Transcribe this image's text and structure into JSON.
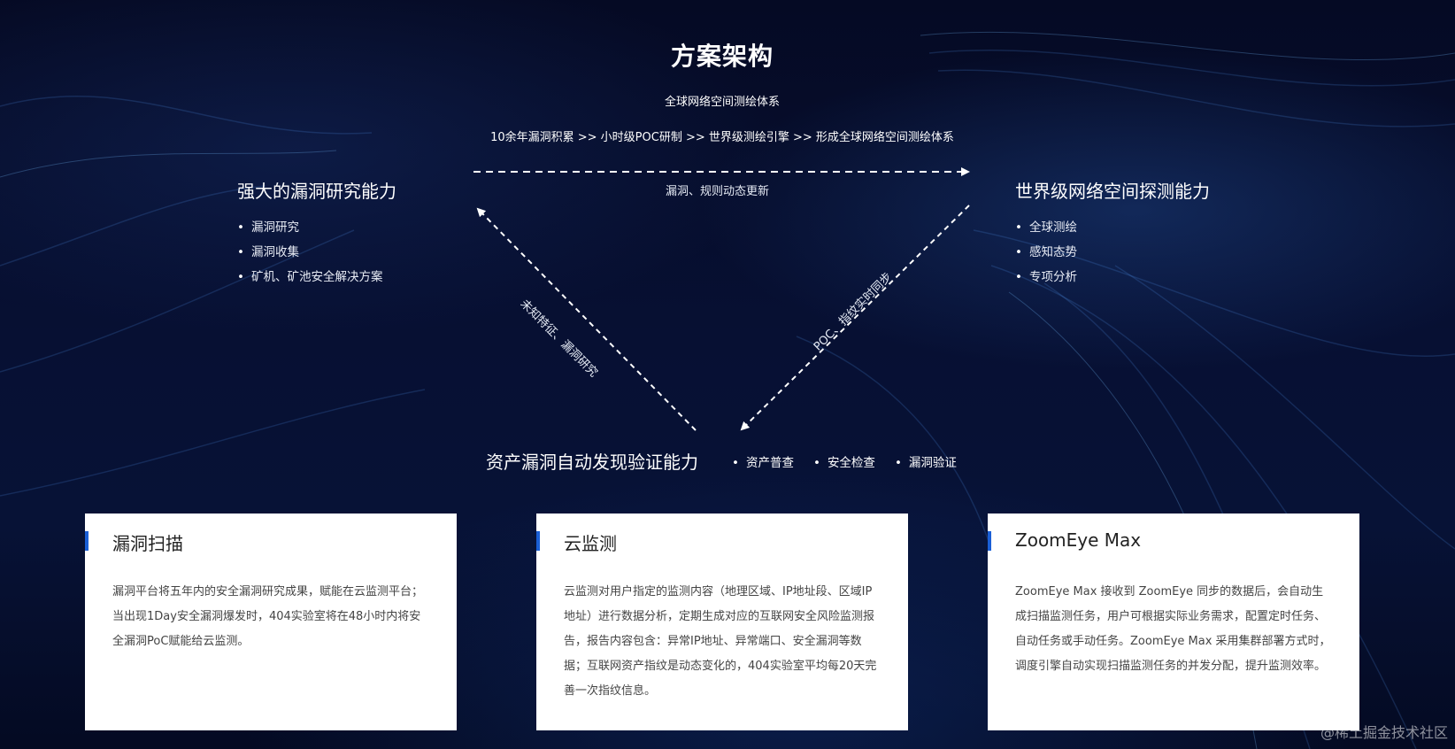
{
  "header": {
    "title": "方案架构",
    "subtitle": "全球网络空间测绘体系",
    "pipeline": "10余年漏洞积累 >> 小时级POC研制 >> 世界级测绘引擎 >> 形成全球网络空间测绘体系"
  },
  "nodes": {
    "left": {
      "title": "强大的漏洞研究能力",
      "items": [
        "漏洞研究",
        "漏洞收集",
        "矿机、矿池安全解决方案"
      ]
    },
    "right": {
      "title": "世界级网络空间探测能力",
      "items": [
        "全球测绘",
        "感知态势",
        "专项分析"
      ]
    },
    "bottom": {
      "title": "资产漏洞自动发现验证能力",
      "items": [
        "资产普查",
        "安全检查",
        "漏洞验证"
      ]
    }
  },
  "edges": {
    "top_label": "漏洞、规则动态更新",
    "left_label": "未知特征、漏洞研究",
    "right_label": "POC、指纹实时同步"
  },
  "cards": [
    {
      "title": "漏洞扫描",
      "body": "漏洞平台将五年内的安全漏洞研究成果，赋能在云监测平台；当出现1Day安全漏洞爆发时，404实验室将在48小时内将安全漏洞PoC赋能给云监测。"
    },
    {
      "title": "云监测",
      "body": "云监测对用户指定的监测内容（地理区域、IP地址段、区域IP地址）进行数据分析，定期生成对应的互联网安全风险监测报告，报告内容包含：异常IP地址、异常端口、安全漏洞等数据；互联网资产指纹是动态变化的，404实验室平均每20天完善一次指纹信息。"
    },
    {
      "title": "ZoomEye Max",
      "body": "ZoomEye Max 接收到 ZoomEye 同步的数据后，会自动生成扫描监测任务，用户可根据实际业务需求，配置定时任务、自动任务或手动任务。ZoomEye Max 采用集群部署方式时，调度引擎自动实现扫描监测任务的并发分配，提升监测效率。"
    }
  ],
  "watermark": "@稀土掘金技术社区",
  "colors": {
    "card_accent": "#1a5fd6",
    "background": "#071033"
  }
}
